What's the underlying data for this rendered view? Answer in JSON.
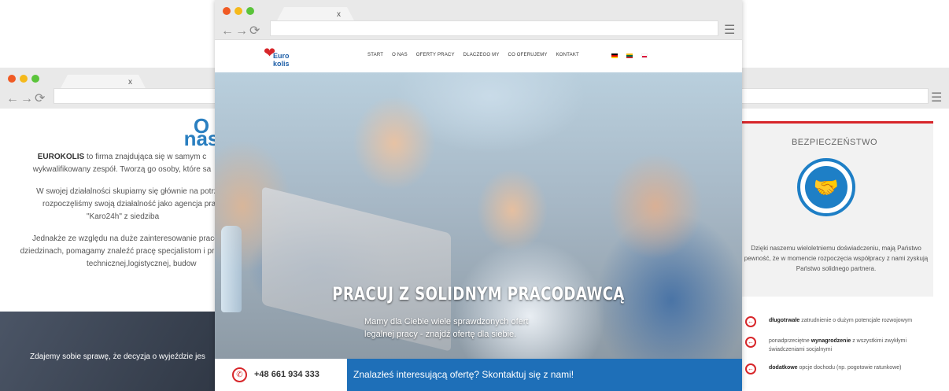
{
  "left_window": {
    "tab_close": "x",
    "title": "O nas",
    "paragraphs": [
      [
        "EUROKOLIS",
        " to firma znajdująca się w samym c"
      ],
      "wykwalifikowany zespół. Tworzą go osoby, które sa",
      "W swojej działalności skupiamy się głównie na potrzeb",
      "rozpoczęliśmy swoją działalność jako agencja pracy c",
      "\"Karo24h\" z siedziba",
      "Jednakże ze względu na duże zainteresowanie pracow",
      "dziedzinach, pomagamy znaleźć pracę specjalistom i pr",
      "technicznej,logistycznej, budow"
    ],
    "dark_banner": "Zdajemy sobie sprawę, że decyzja o wyjeździe jes"
  },
  "right_window": {
    "heading": "BEZPIECZEŃSTWO",
    "description": "Dzięki naszemu wieloletniemu doświadczeniu, mają Państwo pewność, że w momencie rozpoczęcia współpracy z nami zyskują Państwo solidnego partnera.",
    "benefits": [
      {
        "bold": "długotrwałe",
        "text": " zatrudnienie o dużym potencjale rozwojowym"
      },
      {
        "pre": "ponadprzeciętne ",
        "bold": "wynagrodzenie",
        "text": " z wszystkimi zwykłymi świadczeniami socjalnymi"
      },
      {
        "bold": "dodatkowe",
        "text": " opcje dochodu (np. pogotowie ratunkowe)"
      }
    ],
    "accent": "#d7262a"
  },
  "main_window": {
    "tab_close": "x",
    "logo": {
      "line1": "Euro",
      "line2": "kolis"
    },
    "menu": [
      "START",
      "O NAS",
      "OFERTY PRACY",
      "DLACZEGO MY",
      "CO OFERUJEMY",
      "KONTAKT"
    ],
    "languages": [
      "de-flag",
      "lt-flag",
      "pl-flag"
    ],
    "hero_title": "PRACUJ Z SOLIDNYM PRACODAWCĄ",
    "hero_subtitle_1": "Mamy dla Ciebie wiele sprawdzonych ofert",
    "hero_subtitle_2": "legalnej pracy - znajdź ofertę dla siebie.",
    "phone": "+48 661 934 333",
    "cta": "Znalazłeś interesującą ofertę? Skontaktuj się z nami!",
    "brand_blue": "#1e6fb8"
  }
}
